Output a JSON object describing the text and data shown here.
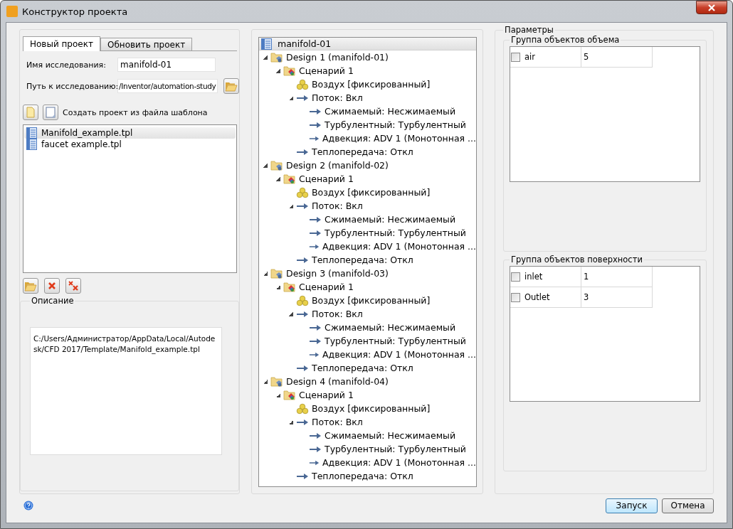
{
  "window": {
    "title": "Конструктор проекта"
  },
  "tabs": [
    {
      "label": "Новый проект",
      "selected": true
    },
    {
      "label": "Обновить проект",
      "selected": false
    }
  ],
  "study_name": {
    "label": "Имя исследования:",
    "value": "manifold-01"
  },
  "study_path": {
    "label": "Путь к исследованию:",
    "value": "/Inventor/automation-study"
  },
  "template_label": "Создать проект из файла шаблона",
  "templates": [
    {
      "name": "Manifold_example.tpl",
      "selected": true
    },
    {
      "name": "faucet example.tpl",
      "selected": false
    }
  ],
  "description": {
    "title": "Описание",
    "text": "C:/Users/Администратор/AppData/Local/Autodesk/CFD 2017/Template/Manifold_example.tpl"
  },
  "tree": {
    "root": "manifold-01",
    "items": [
      {
        "label": "Design 1 (manifold-01)",
        "kind": "design",
        "expanded": true,
        "children": [
          {
            "label": "Сценарий 1",
            "kind": "scenario",
            "expanded": true,
            "children": [
              {
                "label": "Воздух [фиксированный]",
                "kind": "material"
              },
              {
                "label": "Поток: Вкл",
                "kind": "setting",
                "expanded": true,
                "children": [
                  {
                    "label": "Сжимаемый: Несжимаемый",
                    "kind": "setting"
                  },
                  {
                    "label": "Турбулентный: Турбулентный",
                    "kind": "setting"
                  },
                  {
                    "label": "Адвекция: ADV 1 (Монотонная ...",
                    "kind": "setting"
                  }
                ]
              },
              {
                "label": "Теплопередача: Откл",
                "kind": "setting"
              }
            ]
          }
        ]
      },
      {
        "label": "Design 2 (manifold-02)",
        "kind": "design",
        "expanded": true,
        "children": [
          {
            "label": "Сценарий 1",
            "kind": "scenario",
            "expanded": true,
            "children": [
              {
                "label": "Воздух [фиксированный]",
                "kind": "material"
              },
              {
                "label": "Поток: Вкл",
                "kind": "setting",
                "expanded": true,
                "children": [
                  {
                    "label": "Сжимаемый: Несжимаемый",
                    "kind": "setting"
                  },
                  {
                    "label": "Турбулентный: Турбулентный",
                    "kind": "setting"
                  },
                  {
                    "label": "Адвекция: ADV 1 (Монотонная ...",
                    "kind": "setting"
                  }
                ]
              },
              {
                "label": "Теплопередача: Откл",
                "kind": "setting"
              }
            ]
          }
        ]
      },
      {
        "label": "Design 3 (manifold-03)",
        "kind": "design",
        "expanded": true,
        "children": [
          {
            "label": "Сценарий 1",
            "kind": "scenario",
            "expanded": true,
            "children": [
              {
                "label": "Воздух [фиксированный]",
                "kind": "material"
              },
              {
                "label": "Поток: Вкл",
                "kind": "setting",
                "expanded": true,
                "children": [
                  {
                    "label": "Сжимаемый: Несжимаемый",
                    "kind": "setting"
                  },
                  {
                    "label": "Турбулентный: Турбулентный",
                    "kind": "setting"
                  },
                  {
                    "label": "Адвекция: ADV 1 (Монотонная ...",
                    "kind": "setting"
                  }
                ]
              },
              {
                "label": "Теплопередача: Откл",
                "kind": "setting"
              }
            ]
          }
        ]
      },
      {
        "label": "Design 4 (manifold-04)",
        "kind": "design",
        "expanded": true,
        "children": [
          {
            "label": "Сценарий 1",
            "kind": "scenario",
            "expanded": true,
            "children": [
              {
                "label": "Воздух [фиксированный]",
                "kind": "material"
              },
              {
                "label": "Поток: Вкл",
                "kind": "setting",
                "expanded": true,
                "children": [
                  {
                    "label": "Сжимаемый: Несжимаемый",
                    "kind": "setting"
                  },
                  {
                    "label": "Турбулентный: Турбулентный",
                    "kind": "setting"
                  },
                  {
                    "label": "Адвекция: ADV 1 (Монотонная ...",
                    "kind": "setting"
                  }
                ]
              },
              {
                "label": "Теплопередача: Откл",
                "kind": "setting"
              }
            ]
          }
        ]
      }
    ]
  },
  "parameters": {
    "title": "Параметры",
    "groups": [
      {
        "title": "Группа объектов объема",
        "rows": [
          {
            "name": "air",
            "value": "5",
            "checked": false
          }
        ]
      },
      {
        "title": "Группа объектов поверхности",
        "rows": [
          {
            "name": "inlet",
            "value": "1",
            "checked": false
          },
          {
            "name": "Outlet",
            "value": "3",
            "checked": false
          }
        ]
      }
    ]
  },
  "buttons": [
    {
      "label": "Запуск",
      "default": true
    },
    {
      "label": "Отмена",
      "default": false
    }
  ]
}
